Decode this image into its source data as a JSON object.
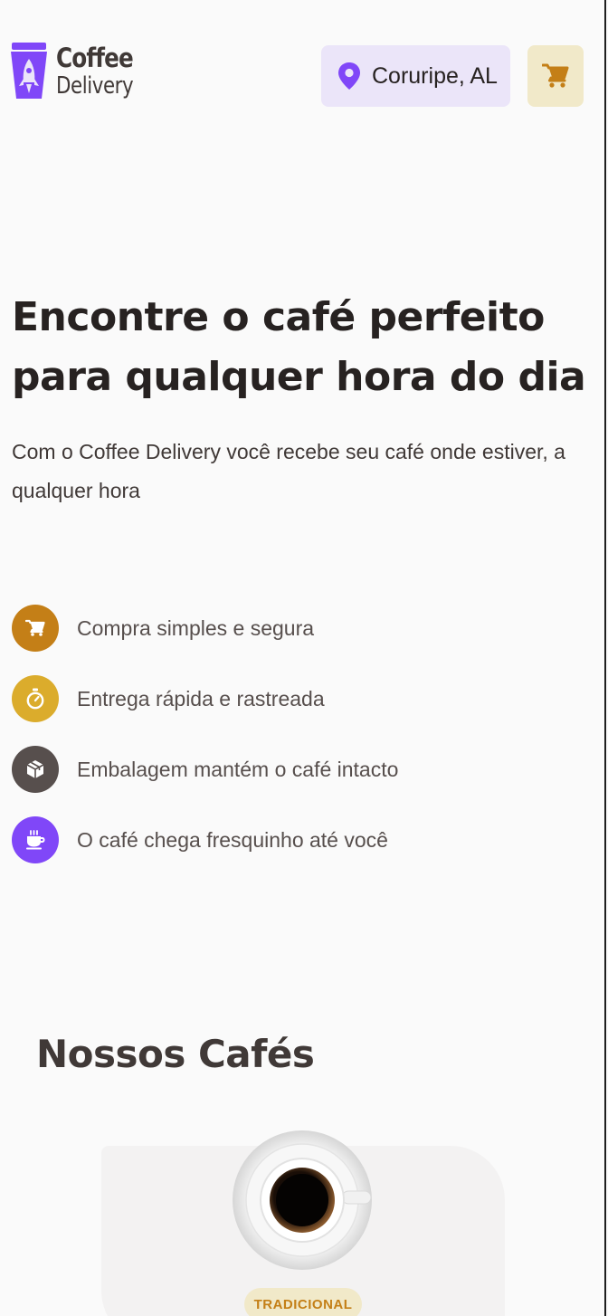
{
  "header": {
    "logo_line1": "Coffee",
    "logo_line2": "Delivery",
    "location": "Coruripe, AL",
    "icons": {
      "location": "map-pin-icon",
      "cart": "shopping-cart-icon"
    }
  },
  "hero": {
    "title": "Encontre o café perfeito para qualquer hora do dia",
    "subtitle": "Com o Coffee Delivery você recebe seu café onde estiver, a qualquer hora"
  },
  "benefits": [
    {
      "label": "Compra simples e segura",
      "icon": "shopping-cart-icon",
      "color": "#C47F17"
    },
    {
      "label": "Entrega rápida e rastreada",
      "icon": "timer-icon",
      "color": "#DBAC2C"
    },
    {
      "label": "Embalagem mantém o café intacto",
      "icon": "package-icon",
      "color": "#574F4D"
    },
    {
      "label": "O café chega fresquinho até você",
      "icon": "coffee-cup-icon",
      "color": "#8047F8"
    }
  ],
  "catalog": {
    "title": "Nossos Cafés",
    "first_item": {
      "tag": "TRADICIONAL",
      "image": "espresso-cup-image"
    }
  },
  "colors": {
    "purple": "#8047F8",
    "purple_light": "#EBE5F9",
    "yellow_dark": "#C47F17",
    "yellow_light": "#F1E9C9",
    "background": "#FAFAFA"
  }
}
